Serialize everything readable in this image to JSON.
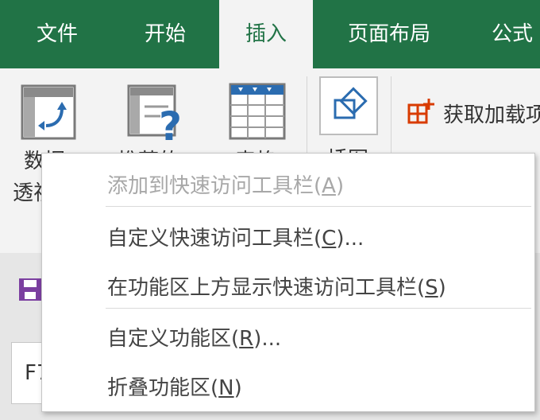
{
  "tabs": [
    {
      "label": "文件",
      "active": false
    },
    {
      "label": "开始",
      "active": false
    },
    {
      "label": "插入",
      "active": true
    },
    {
      "label": "页面布局",
      "active": false
    },
    {
      "label": "公式",
      "active": false
    }
  ],
  "ribbon": {
    "pivot_label_line1": "数据",
    "pivot_label_line2": "透视",
    "recommended_pivot_label": "推荐的",
    "table_label": "表格",
    "illustrations_label": "插图",
    "get_addins_label": "获取加载项"
  },
  "namebox": {
    "value": "F7"
  },
  "context_menu": {
    "items": [
      {
        "text": "添加到快速访问工具栏(",
        "key": "A",
        "tail": ")",
        "disabled": true
      },
      {
        "text": "自定义快速访问工具栏(",
        "key": "C",
        "tail": ")...",
        "disabled": false
      },
      {
        "text": "在功能区上方显示快速访问工具栏(",
        "key": "S",
        "tail": ")",
        "disabled": false
      },
      {
        "text": "自定义功能区(",
        "key": "R",
        "tail": ")...",
        "disabled": false
      },
      {
        "text": "折叠功能区(",
        "key": "N",
        "tail": ")",
        "disabled": false
      }
    ]
  },
  "colors": {
    "tab_bar": "#217346",
    "accent_red": "#d83b01",
    "icon_blue": "#2b6cb0",
    "save_purple": "#7b3fa0"
  }
}
